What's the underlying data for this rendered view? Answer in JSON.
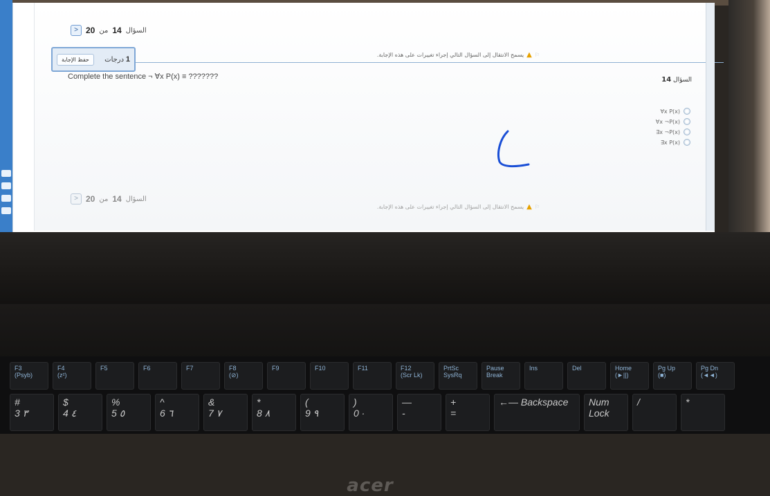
{
  "quiz": {
    "nav_top": {
      "prefix": "السؤال",
      "current": "14",
      "of": "من",
      "total": "20"
    },
    "nav_bottom": {
      "prefix": "السؤال",
      "current": "14",
      "of": "من",
      "total": "20"
    },
    "grade": {
      "value": "1",
      "unit": "درجات"
    },
    "save_label": "حفظ الإجابة",
    "warning_text": "يسمح الانتقال إلى السؤال التالي إجراء تغييرات على هذه الإجابة.",
    "question_label": "السؤال",
    "question_number": "14",
    "question_text": "Complete the sentence ¬ ∀x P(x) ≡ ???????",
    "choices": [
      "∀x P(x)",
      "∀x ¬P(x)",
      "∃x ¬P(x)",
      "∃x P(x)"
    ]
  },
  "device": {
    "brand": "acer"
  },
  "keyboard": {
    "fn_row": [
      {
        "key": "F3",
        "sub": "(Psyb)"
      },
      {
        "key": "F4",
        "sub": "(z²)"
      },
      {
        "key": "F5",
        "sub": ""
      },
      {
        "key": "F6",
        "sub": ""
      },
      {
        "key": "F7",
        "sub": ""
      },
      {
        "key": "F8",
        "sub": "(⊘)"
      },
      {
        "key": "F9",
        "sub": ""
      },
      {
        "key": "F10",
        "sub": ""
      },
      {
        "key": "F11",
        "sub": ""
      },
      {
        "key": "F12",
        "sub": "(Scr Lk)"
      },
      {
        "key": "PrtSc",
        "sub": "SysRq"
      },
      {
        "key": "Pause",
        "sub": "Break"
      },
      {
        "key": "Ins",
        "sub": ""
      },
      {
        "key": "Del",
        "sub": ""
      },
      {
        "key": "Home",
        "sub": "(►||)"
      },
      {
        "key": "Pg Up",
        "sub": "(■)"
      },
      {
        "key": "Pg Dn",
        "sub": "(◄◄)"
      }
    ],
    "num_row": [
      {
        "top": "#",
        "bottom": "3 ٣"
      },
      {
        "top": "$",
        "bottom": "4 ٤"
      },
      {
        "top": "%",
        "bottom": "5 ٥"
      },
      {
        "top": "^",
        "bottom": "6 ٦"
      },
      {
        "top": "&",
        "bottom": "7 ٧"
      },
      {
        "top": "*",
        "bottom": "8 ٨"
      },
      {
        "top": "(",
        "bottom": "9 ٩"
      },
      {
        "top": ")",
        "bottom": "0 ·"
      },
      {
        "top": "—",
        "bottom": "-"
      },
      {
        "top": "+",
        "bottom": "="
      },
      {
        "top": "←— Backspace",
        "bottom": ""
      },
      {
        "top": "Num",
        "bottom": "Lock"
      },
      {
        "top": "/",
        "bottom": ""
      },
      {
        "top": "*",
        "bottom": ""
      }
    ]
  },
  "colors": {
    "accent": "#7ea7d6",
    "warning": "#e6a100",
    "ink": "#1a4fd6"
  }
}
